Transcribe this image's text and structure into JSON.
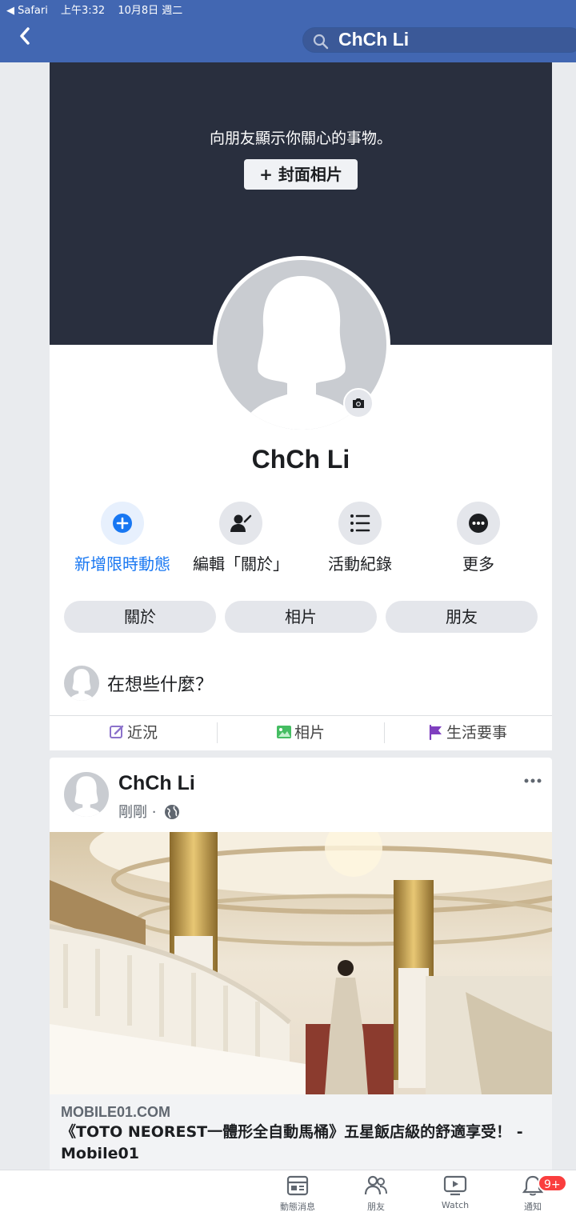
{
  "status_bar": {
    "back_app": "◀ Safari",
    "time": "上午3:32",
    "date": "10月8日 週二"
  },
  "header": {
    "search_text": "ChCh Li"
  },
  "cover": {
    "prompt": "向朋友顯示你關心的事物。",
    "button_label": "+ 封面相片"
  },
  "profile": {
    "name": "ChCh Li"
  },
  "actions": [
    {
      "label": "新增限時動態",
      "icon": "plus-circle-icon"
    },
    {
      "label": "編輯「關於」",
      "icon": "person-edit-icon"
    },
    {
      "label": "活動紀錄",
      "icon": "list-icon"
    },
    {
      "label": "更多",
      "icon": "more-dots-icon"
    }
  ],
  "pills": [
    "關於",
    "相片",
    "朋友"
  ],
  "composer": {
    "placeholder": "在想些什麼？"
  },
  "quickbar": [
    {
      "label": "近況",
      "icon": "edit-square-icon",
      "color": "#8c72cb"
    },
    {
      "label": "相片",
      "icon": "photo-icon",
      "color": "#45bd62"
    },
    {
      "label": "生活要事",
      "icon": "flag-icon",
      "color": "#7f3fbf"
    }
  ],
  "post": {
    "author": "ChCh Li",
    "time": "剛剛 ·",
    "link": {
      "domain": "MOBILE01.COM",
      "title": "《TOTO NEOREST一體形全自動馬桶》五星飯店級的舒適享受！ - Mobile01"
    }
  },
  "bottom_nav": [
    {
      "label": "動態消息",
      "icon": "news-feed-icon"
    },
    {
      "label": "朋友",
      "icon": "friends-icon"
    },
    {
      "label": "Watch",
      "icon": "watch-icon"
    },
    {
      "label": "通知",
      "icon": "bell-icon"
    }
  ],
  "notification_badge": "9+",
  "colors": {
    "header": "#4267b2",
    "cover": "#292f3e",
    "accent": "#1877f2",
    "badge": "#fa3e3e"
  }
}
